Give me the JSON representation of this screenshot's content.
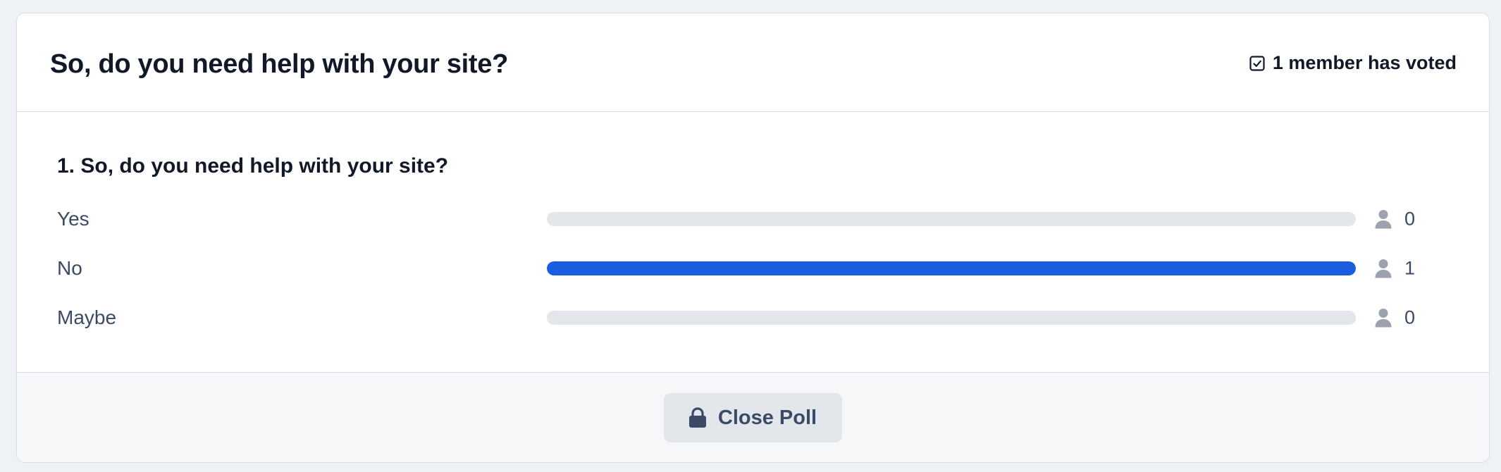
{
  "poll": {
    "title": "So, do you need help with your site?",
    "voted_text": "1 member has voted",
    "voted_icon": "checkbox-checked-icon"
  },
  "question": {
    "title": "1. So, do you need help with your site?",
    "options": [
      {
        "label": "Yes",
        "count": "0",
        "fraction": 0
      },
      {
        "label": "No",
        "count": "1",
        "fraction": 1
      },
      {
        "label": "Maybe",
        "count": "0",
        "fraction": 0
      }
    ],
    "count_icon": "user-icon"
  },
  "footer": {
    "close_label": "Close Poll",
    "close_icon": "lock-icon"
  },
  "colors": {
    "accent": "#1b5de0",
    "track": "#e3e6eb",
    "text_muted": "#3b4a66",
    "icon_muted": "#9ca3af"
  }
}
